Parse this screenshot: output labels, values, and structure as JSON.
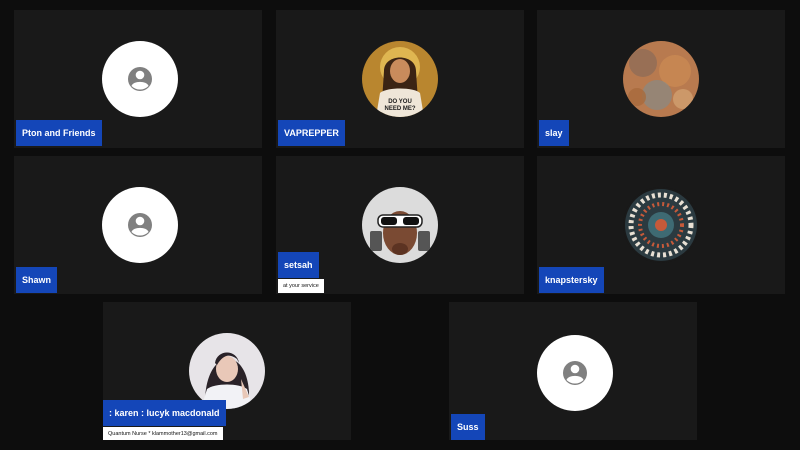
{
  "participants": [
    {
      "name": "Pton and Friends",
      "avatar": "default-user-icon"
    },
    {
      "name": "VAPREPPER",
      "avatar": "jesus-portrait-avatar",
      "avatar_text": "DO YOU NEED ME?"
    },
    {
      "name": "slay",
      "avatar": "rust-texture-avatar"
    },
    {
      "name": "Shawn",
      "avatar": "default-user-icon"
    },
    {
      "name": "setsah",
      "avatar": "dog-with-sunglasses-avatar",
      "status": "at your service"
    },
    {
      "name": "knapstersky",
      "avatar": "mandala-pattern-avatar"
    },
    {
      "name": ": karen : lucyk macdonald",
      "avatar": "woman-photo-avatar",
      "status": "Quantum Nurse * klammother13@gmail.com"
    },
    {
      "name": "Suss",
      "avatar": "default-user-icon"
    }
  ],
  "colors": {
    "background": "#0d0d0d",
    "tile": "#191919",
    "name_tag": "#1446b8",
    "name_text": "#ffffff",
    "avatar_default_bg": "#ffffff",
    "avatar_default_icon": "#808080"
  }
}
